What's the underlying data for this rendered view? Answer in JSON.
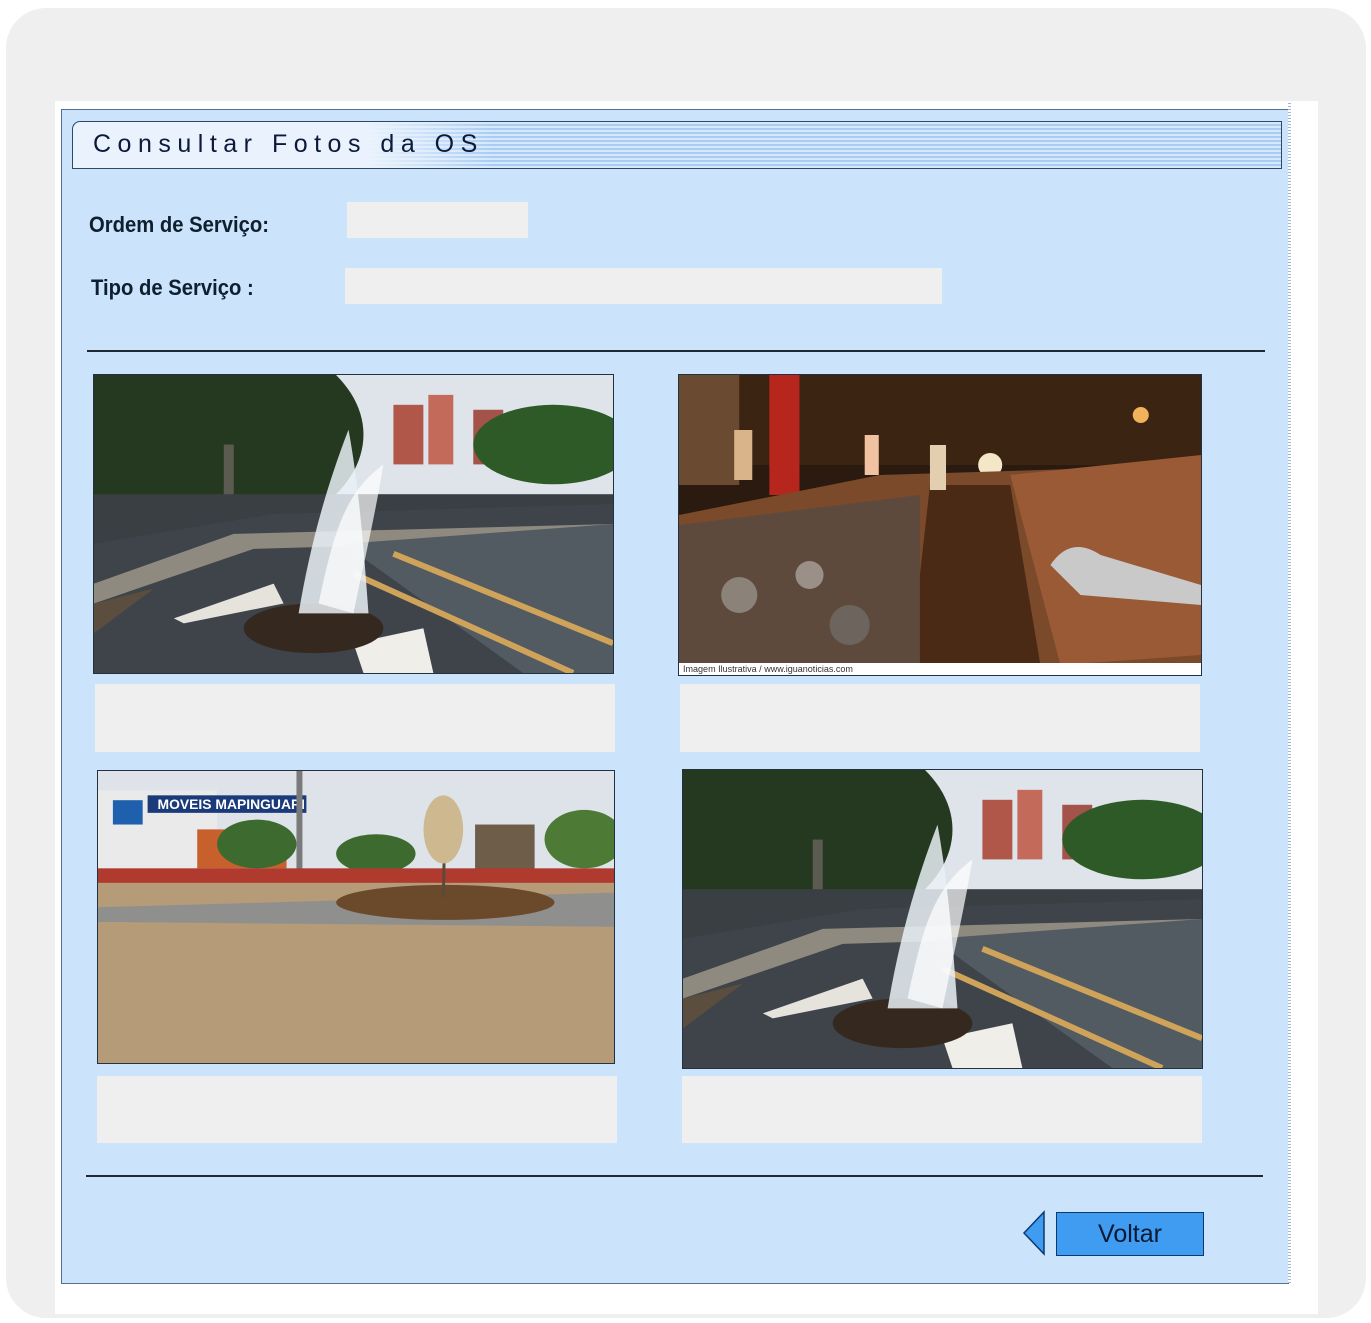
{
  "page": {
    "title": "Consultar Fotos da OS"
  },
  "form": {
    "ordem_label": "Ordem de Serviço:",
    "ordem_value": "",
    "tipo_label": "Tipo de Serviço :",
    "tipo_value": ""
  },
  "photos": [
    {
      "subject": "water-leak-street-photo",
      "caption": ""
    },
    {
      "subject": "night-excavation-photo",
      "credit": "Imagem Ilustrativa / www.iguanoticias.com",
      "caption": ""
    },
    {
      "subject": "repaired-road-photo",
      "sign_text": "MOVEIS MAPINGUARI",
      "caption": ""
    },
    {
      "subject": "water-leak-street-photo",
      "caption": ""
    }
  ],
  "actions": {
    "voltar_label": "Voltar",
    "voltar_icon": "back-arrow-icon"
  },
  "colors": {
    "panel": "#cbe4fb",
    "button": "#3f9cf1",
    "field": "#efefef"
  }
}
